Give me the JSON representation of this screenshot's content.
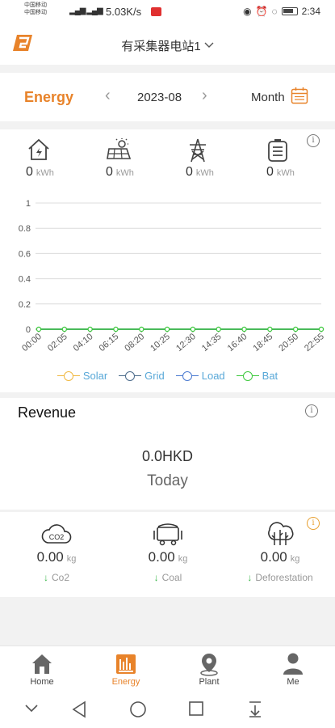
{
  "status": {
    "carrier1": "中国移动",
    "carrier2": "中国移动",
    "speed": "5.03K/s",
    "battery_pct": "88",
    "time": "2:34"
  },
  "header": {
    "station": "有采集器电站1"
  },
  "datebar": {
    "tab": "Energy",
    "date": "2023-08",
    "mode": "Month"
  },
  "metrics": [
    {
      "icon": "home-icon",
      "value": "0",
      "unit": "kWh"
    },
    {
      "icon": "solar-panel-icon",
      "value": "0",
      "unit": "kWh"
    },
    {
      "icon": "grid-tower-icon",
      "value": "0",
      "unit": "kWh"
    },
    {
      "icon": "battery-icon",
      "value": "0",
      "unit": "kWh"
    }
  ],
  "chart_data": {
    "type": "line",
    "x": [
      "00:00",
      "02:05",
      "04:10",
      "06:15",
      "08:20",
      "10:25",
      "12:30",
      "14:35",
      "16:40",
      "18:45",
      "20:50",
      "22:55"
    ],
    "y_ticks": [
      "0",
      "0.2",
      "0.4",
      "0.6",
      "0.8",
      "1"
    ],
    "ylim": [
      0,
      1
    ],
    "series": [
      {
        "name": "Solar",
        "color": "#f0b840",
        "values": [
          0,
          0,
          0,
          0,
          0,
          0,
          0,
          0,
          0,
          0,
          0,
          0
        ]
      },
      {
        "name": "Grid",
        "color": "#4a6a8a",
        "values": [
          0,
          0,
          0,
          0,
          0,
          0,
          0,
          0,
          0,
          0,
          0,
          0
        ]
      },
      {
        "name": "Load",
        "color": "#4a7ad0",
        "values": [
          0,
          0,
          0,
          0,
          0,
          0,
          0,
          0,
          0,
          0,
          0,
          0
        ]
      },
      {
        "name": "Bat",
        "color": "#3cc83c",
        "values": [
          0,
          0,
          0,
          0,
          0,
          0,
          0,
          0,
          0,
          0,
          0,
          0
        ]
      }
    ],
    "grid": true,
    "legend": "bottom"
  },
  "revenue": {
    "title": "Revenue",
    "amount": "0.0HKD",
    "period": "Today"
  },
  "environment": [
    {
      "icon": "co2-cloud-icon",
      "value": "0.00",
      "unit": "kg",
      "label": "Co2"
    },
    {
      "icon": "coal-cart-icon",
      "value": "0.00",
      "unit": "kg",
      "label": "Coal"
    },
    {
      "icon": "trees-icon",
      "value": "0.00",
      "unit": "kg",
      "label": "Deforestation"
    }
  ],
  "nav": [
    {
      "label": "Home",
      "icon": "home-icon",
      "active": false
    },
    {
      "label": "Energy",
      "icon": "energy-chart-icon",
      "active": true
    },
    {
      "label": "Plant",
      "icon": "location-pin-icon",
      "active": false
    },
    {
      "label": "Me",
      "icon": "person-icon",
      "active": false
    }
  ],
  "colors": {
    "accent": "#e8832a",
    "legend_text": "#58a8d8",
    "positive": "#3bb84a"
  }
}
